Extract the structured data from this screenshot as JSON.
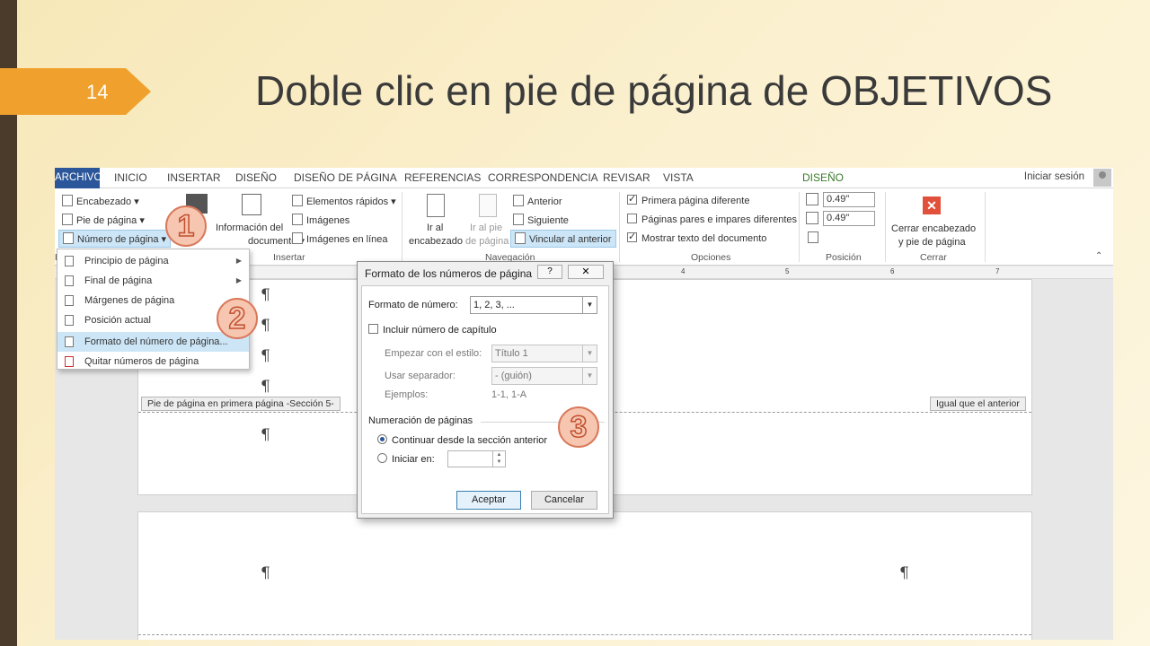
{
  "slide": {
    "number": "14",
    "title": "Doble clic en pie de página de OBJETIVOS"
  },
  "tabs": [
    "ARCHIVO",
    "INICIO",
    "INSERTAR",
    "DISEÑO",
    "DISEÑO DE PÁGINA",
    "REFERENCIAS",
    "CORRESPONDENCIA",
    "REVISAR",
    "VISTA",
    "DISEÑO"
  ],
  "signin": "Iniciar sesión",
  "ribbon": {
    "encabezado": "Encabezado ▾",
    "pie_de_pagina": "Pie de página ▾",
    "numero_de_pagina": "Número de página ▾",
    "info_doc_1": "Información del",
    "info_doc_2": "documento ▾",
    "elementos_rapidos": "Elementos rápidos ▾",
    "imagenes": "Imágenes",
    "imagenes_en_linea": "Imágenes en línea",
    "insertar_label": "Insertar",
    "ir_encabezado_1": "Ir al",
    "ir_encabezado_2": "encabezado",
    "ir_pie_1": "Ir al pie",
    "ir_pie_2": "de página",
    "anterior": "Anterior",
    "siguiente": "Siguiente",
    "vincular": "Vincular al anterior",
    "navegacion_label": "Navegación",
    "primera_pagina": "Primera página diferente",
    "pares_impares": "Páginas pares e impares diferentes",
    "mostrar_texto": "Mostrar texto del documento",
    "opciones_label": "Opciones",
    "pos_top": "0.49\"",
    "pos_bottom": "0.49\"",
    "posicion_label": "Posición",
    "cerrar_1": "Cerrar encabezado",
    "cerrar_2": "y pie de página",
    "cerrar_label": "Cerrar",
    "tab_e_fragment": "E"
  },
  "ruler_numbers": [
    "4",
    "5",
    "6",
    "7"
  ],
  "menu": {
    "items": [
      "Principio de página",
      "Final de página",
      "Márgenes de página",
      "Posición actual",
      "Formato del número de página...",
      "Quitar números de página"
    ]
  },
  "document": {
    "pilcrow": "¶",
    "footer_label": "Pie de página en primera página -Sección 5-",
    "same_as_previous": "Igual que el anterior"
  },
  "dialog": {
    "title": "Formato de los números de página",
    "help": "?",
    "close": "✕",
    "formato_label": "Formato de número:",
    "formato_value": "1, 2, 3, ...",
    "incluir_capitulo": "Incluir número de capítulo",
    "empezar_label": "Empezar con el estilo:",
    "empezar_value": "Título 1",
    "separador_label": "Usar separador:",
    "separador_value": "-    (guión)",
    "ejemplos_label": "Ejemplos:",
    "ejemplos_value": "1-1, 1-A",
    "numeracion_label": "Numeración de páginas",
    "continuar": "Continuar desde la sección anterior",
    "iniciar_en": "Iniciar en:",
    "aceptar": "Aceptar",
    "cancelar": "Cancelar"
  },
  "steps": [
    "1",
    "2",
    "3"
  ]
}
